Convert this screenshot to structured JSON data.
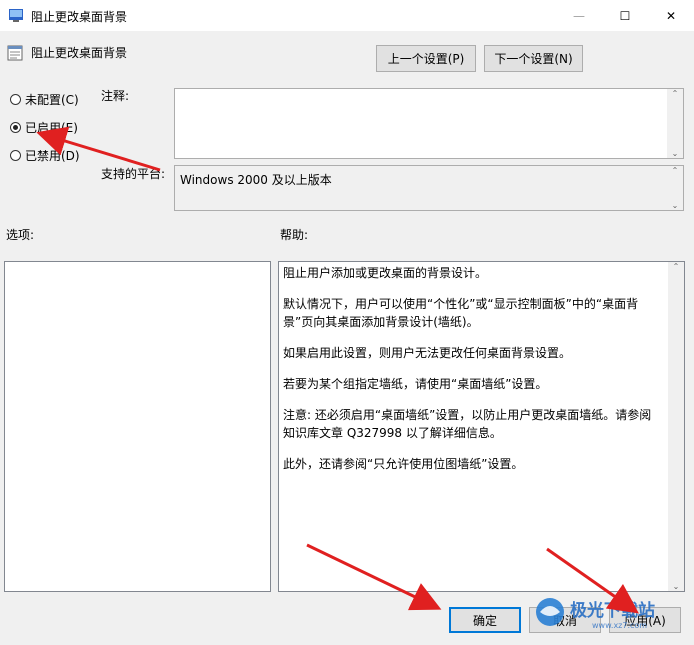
{
  "window": {
    "title": "阻止更改桌面背景",
    "controls": {
      "minimize": "—",
      "maximize": "☐",
      "close": "✕"
    }
  },
  "header": {
    "policy_name": "阻止更改桌面背景"
  },
  "nav": {
    "prev_label": "上一个设置(P)",
    "next_label": "下一个设置(N)"
  },
  "state": {
    "options": [
      {
        "label": "未配置(C)",
        "selected": false
      },
      {
        "label": "已启用(E)",
        "selected": true
      },
      {
        "label": "已禁用(D)",
        "selected": false
      }
    ]
  },
  "comment": {
    "label": "注释:",
    "value": ""
  },
  "platform": {
    "label": "支持的平台:",
    "value": "Windows 2000 及以上版本"
  },
  "options_section": {
    "label": "选项:"
  },
  "help_section": {
    "label": "帮助:",
    "paragraphs": [
      "阻止用户添加或更改桌面的背景设计。",
      "默认情况下，用户可以使用“个性化”或“显示控制面板”中的“桌面背景”页向其桌面添加背景设计(墙纸)。",
      "如果启用此设置，则用户无法更改任何桌面背景设置。",
      "若要为某个组指定墙纸，请使用“桌面墙纸”设置。",
      "注意: 还必须启用“桌面墙纸”设置，以防止用户更改桌面墙纸。请参阅知识库文章 Q327998 以了解详细信息。",
      "此外，还请参阅“只允许使用位图墙纸”设置。"
    ]
  },
  "footer": {
    "ok_label": "确定",
    "cancel_label": "取消",
    "apply_label": "应用(A)"
  },
  "watermark": {
    "text": "极光下载站",
    "subtext": "www.xz7.com"
  },
  "colors": {
    "accent": "#0078d7",
    "arrow": "#e02020",
    "dialog_bg": "#f0f0f0"
  },
  "icons": [
    "policy-icon",
    "arrow-annotation"
  ]
}
